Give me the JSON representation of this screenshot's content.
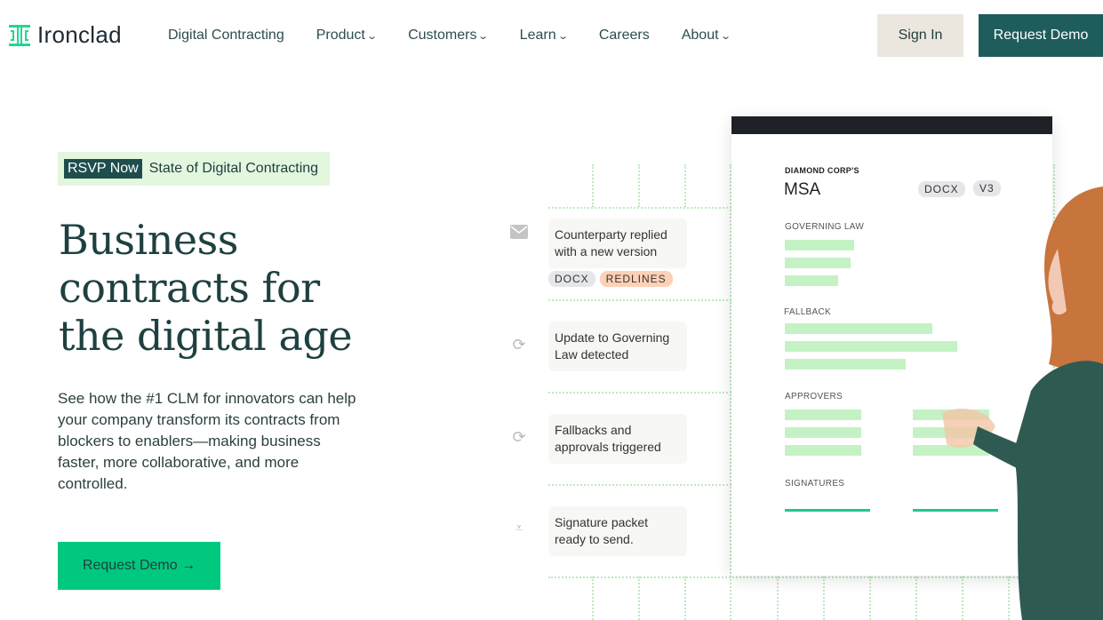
{
  "header": {
    "brand": "Ironclad",
    "nav": [
      {
        "label": "Digital Contracting",
        "dropdown": false
      },
      {
        "label": "Product",
        "dropdown": true
      },
      {
        "label": "Customers",
        "dropdown": true
      },
      {
        "label": "Learn",
        "dropdown": true
      },
      {
        "label": "Careers",
        "dropdown": false
      },
      {
        "label": "About",
        "dropdown": true
      }
    ],
    "sign_in": "Sign In",
    "request_demo": "Request Demo"
  },
  "hero": {
    "badge_tag": "RSVP Now",
    "badge_text": "State of Digital Contracting",
    "headline_lines": [
      "Business",
      "contracts for",
      "the digital age"
    ],
    "paragraph": "See how the #1 CLM for innovators can help your company transform its contracts from blockers to enablers—making business faster, more collaborative, and more controlled.",
    "cta": "Request Demo →"
  },
  "events": [
    {
      "icon": "mail-icon",
      "text": "Counterparty replied with a new version",
      "tags": [
        "DOCX",
        "REDLINES"
      ]
    },
    {
      "icon": "sync-icon",
      "text": "Update to Governing Law detected"
    },
    {
      "icon": "sync-icon",
      "text": "Fallbacks and approvals triggered"
    },
    {
      "icon": "signature-icon",
      "text": "Signature packet ready to send."
    }
  ],
  "document": {
    "company": "DIAMOND CORP'S",
    "title": "MSA",
    "tags": [
      "DOCX",
      "V3"
    ],
    "sections": [
      "GOVERNING LAW",
      "FALLBACK",
      "APPROVERS",
      "SIGNATURES"
    ]
  },
  "colors": {
    "brand_green": "#00c97f",
    "dark_teal": "#1f5c5c",
    "highlight": "#c4f2c4"
  }
}
